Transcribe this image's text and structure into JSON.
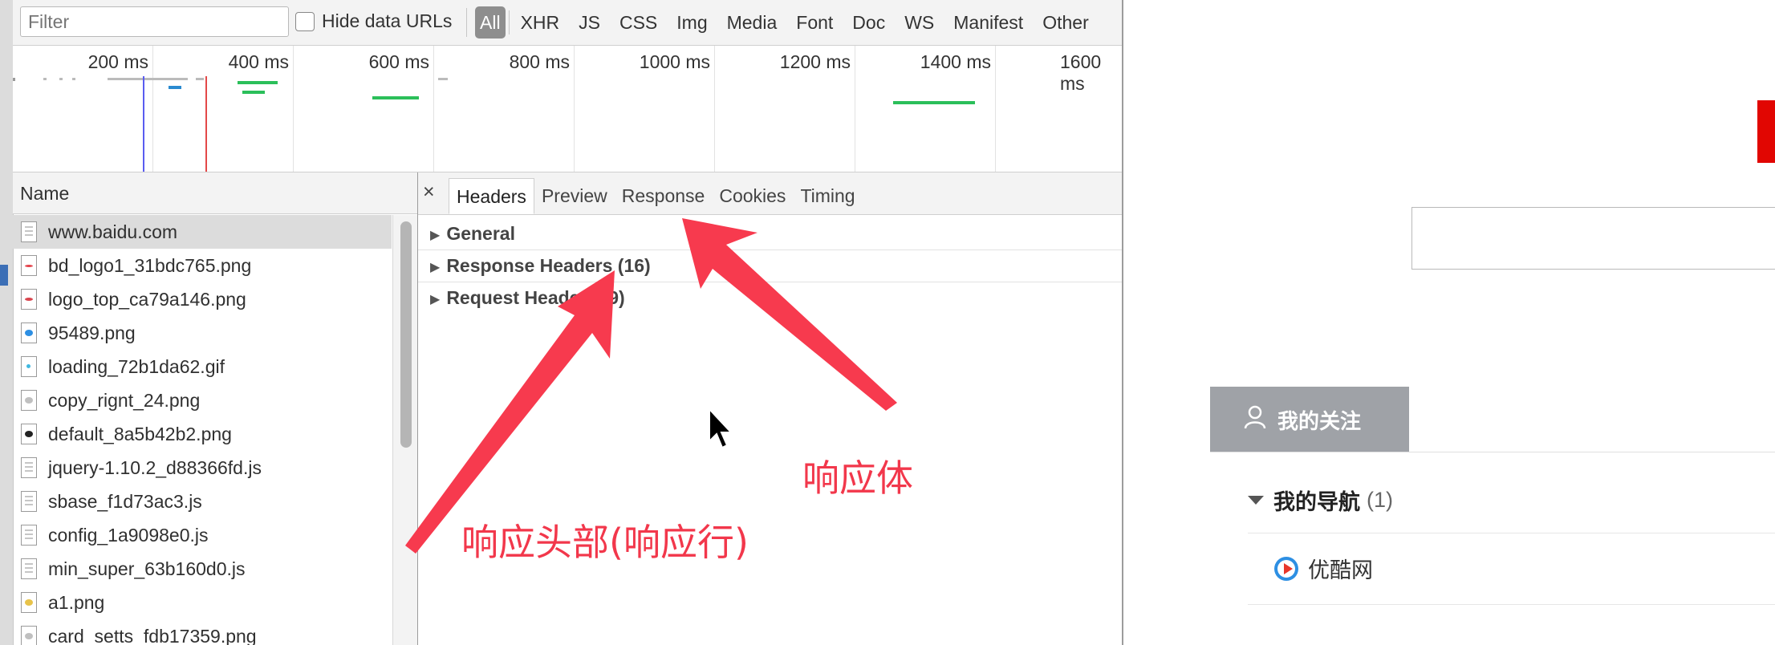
{
  "filterbar": {
    "filter_placeholder": "Filter",
    "hide_data_urls_label": "Hide data URLs",
    "types": [
      "All",
      "XHR",
      "JS",
      "CSS",
      "Img",
      "Media",
      "Font",
      "Doc",
      "WS",
      "Manifest",
      "Other"
    ]
  },
  "overview": {
    "ticks": [
      "200 ms",
      "400 ms",
      "600 ms",
      "800 ms",
      "1000 ms",
      "1200 ms",
      "1400 ms",
      "1600 ms"
    ]
  },
  "requests": {
    "header": "Name",
    "items": [
      {
        "name": "www.baidu.com",
        "icon": "document-icon",
        "selected": true
      },
      {
        "name": "bd_logo1_31bdc765.png",
        "icon": "image-icon"
      },
      {
        "name": "logo_top_ca79a146.png",
        "icon": "image-icon"
      },
      {
        "name": "95489.png",
        "icon": "image-icon"
      },
      {
        "name": "loading_72b1da62.gif",
        "icon": "image-icon"
      },
      {
        "name": "copy_rignt_24.png",
        "icon": "image-icon"
      },
      {
        "name": "default_8a5b42b2.png",
        "icon": "image-icon"
      },
      {
        "name": "jquery-1.10.2_d88366fd.js",
        "icon": "script-icon"
      },
      {
        "name": "sbase_f1d73ac3.js",
        "icon": "script-icon"
      },
      {
        "name": "config_1a9098e0.js",
        "icon": "script-icon"
      },
      {
        "name": "min_super_63b160d0.js",
        "icon": "script-icon"
      },
      {
        "name": "a1.png",
        "icon": "image-icon"
      },
      {
        "name": "card_setts_fdb17359.png",
        "icon": "image-icon"
      }
    ]
  },
  "detail": {
    "close": "×",
    "tabs": [
      "Headers",
      "Preview",
      "Response",
      "Cookies",
      "Timing"
    ],
    "sections": [
      "General",
      "Response Headers (16)",
      "Request Headers (9)"
    ]
  },
  "annotations": {
    "response_body": "响应体",
    "response_headers": "响应头部(响应行)"
  },
  "webpage": {
    "follow_tab": "我的关注",
    "nav_title": "我的导航",
    "nav_count": "(1)",
    "nav_item": "优酷网"
  },
  "colors": {
    "annotation": "#f2374b",
    "selected_row": "#dcdcdc",
    "follow_tab": "#9fa2a7"
  }
}
